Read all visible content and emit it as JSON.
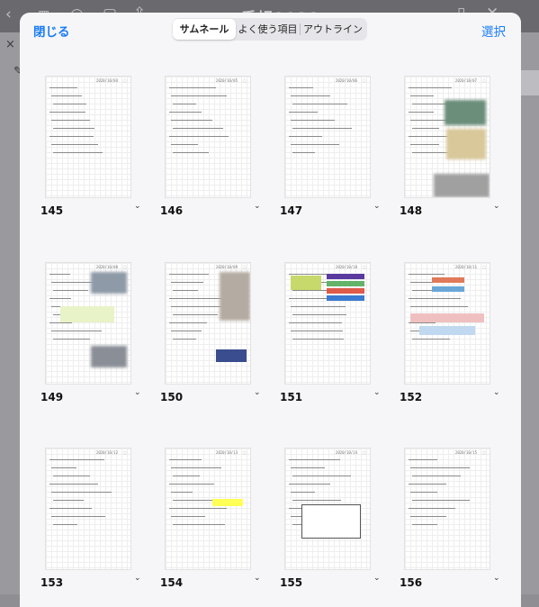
{
  "background": {
    "title": "手帳2020"
  },
  "sheet": {
    "close_label": "閉じる",
    "select_label": "選択",
    "tabs": [
      {
        "label": "サムネール",
        "active": true
      },
      {
        "label": "よく使う項目",
        "active": false
      },
      {
        "label": "アウトライン",
        "active": false
      }
    ]
  },
  "pages": [
    {
      "number": "145",
      "date": "2020/10/04"
    },
    {
      "number": "146",
      "date": "2020/10/05"
    },
    {
      "number": "147",
      "date": "2020/10/06"
    },
    {
      "number": "148",
      "date": "2020/10/07"
    },
    {
      "number": "149",
      "date": "2020/10/08"
    },
    {
      "number": "150",
      "date": "2020/10/09"
    },
    {
      "number": "151",
      "date": "2020/10/10"
    },
    {
      "number": "152",
      "date": "2020/10/11"
    },
    {
      "number": "153",
      "date": "2020/10/12"
    },
    {
      "number": "154",
      "date": "2020/10/13"
    },
    {
      "number": "155",
      "date": "2020/10/14"
    },
    {
      "number": "156",
      "date": "2020/10/15"
    }
  ],
  "colors": {
    "accent": "#1a7cf5"
  },
  "icons": {
    "menu_chevron": "chevron-down-icon",
    "page_star": "star-icon"
  }
}
